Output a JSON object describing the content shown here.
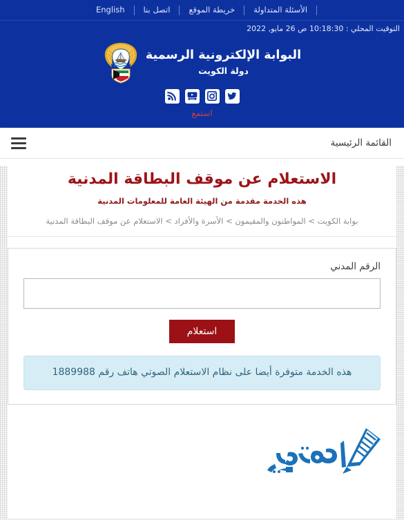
{
  "topbar": {
    "links": [
      {
        "label": "الأسئلة المتداولة",
        "name": "faq"
      },
      {
        "label": "خريطة الموقع",
        "name": "sitemap"
      },
      {
        "label": "اتصل بنا",
        "name": "contact-us"
      },
      {
        "label": "English",
        "name": "english"
      }
    ],
    "local_time": "التوقيت المحلي : 10:18:30 ص 26 مايو, 2022"
  },
  "brand": {
    "title": "البوابة الإلكترونية الرسمية",
    "subtitle": "دولة  الكويت",
    "emblem_name": "kuwait-state-emblem"
  },
  "social": {
    "items": [
      {
        "name": "rss-icon",
        "label": "RSS"
      },
      {
        "name": "youtube-icon",
        "label": "YouTube"
      },
      {
        "name": "instagram-icon",
        "label": "Instagram"
      },
      {
        "name": "twitter-icon",
        "label": "Twitter"
      }
    ],
    "listen_label": "استمع"
  },
  "nav": {
    "title": "القائمة الرئيسية",
    "menu_icon": "hamburger-menu-icon"
  },
  "page": {
    "title": "الاستعلام عن موقف البطاقة المدنية",
    "subtitle": "هذه الخدمة مقدمة من الهيئة العامة للمعلومات المدنية",
    "breadcrumb": "بوابة الكويت > المواطنون والمقيمون > الأسرة والأفراد > الاستعلام عن موقف البطاقة المدنية"
  },
  "form": {
    "civil_number_label": "الرقم المدني",
    "civil_number_value": "",
    "civil_number_placeholder": "",
    "submit_label": "استعلام"
  },
  "alert": {
    "text": "هذه الخدمة متوفرة أيضا على نظام الاستعلام الصوتي هاتف رقم 1889988",
    "phone": "1889988"
  },
  "footer": {
    "logo_name": "mohtawa-logo",
    "logo_text": "محتوى"
  },
  "colors": {
    "brand_blue": "#0d32a0",
    "accent_red": "#9c1419",
    "button_red": "#9c1115",
    "info_bg": "#d7edf5",
    "info_text": "#2f6580",
    "listen_red": "#c8404a",
    "logo_blue": "#1b72b8"
  }
}
